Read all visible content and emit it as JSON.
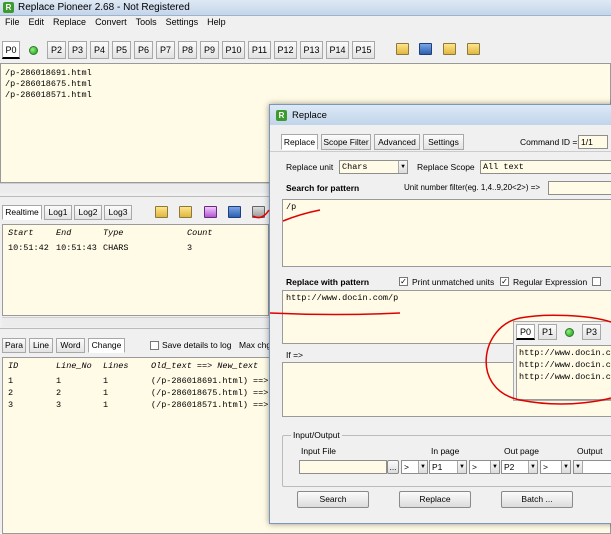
{
  "app": {
    "title": "Replace Pioneer 2.68 - Not Registered",
    "logo": "R"
  },
  "menu": [
    "File",
    "Edit",
    "Replace",
    "Convert",
    "Tools",
    "Settings",
    "Help"
  ],
  "ptabs": [
    "P0",
    "P2",
    "P3",
    "P4",
    "P5",
    "P6",
    "P7",
    "P8",
    "P9",
    "P10",
    "P11",
    "P12",
    "P13",
    "P14",
    "P15"
  ],
  "toolbar_icons": [
    "open-folder-icon",
    "save-icon",
    "export-icon",
    "excel-icon"
  ],
  "text_panel": {
    "lines": [
      "/p-286018691.html",
      "/p-286018675.html",
      "/p-286018571.html"
    ]
  },
  "log": {
    "tabs": [
      "Realtime",
      "Log1",
      "Log2",
      "Log3"
    ],
    "headers": [
      "Start",
      "End",
      "Type",
      "Count"
    ],
    "rows": [
      [
        "10:51:42",
        "10:51:43",
        "CHARS",
        "3"
      ]
    ]
  },
  "change": {
    "tabs": [
      "Para",
      "Line",
      "Word",
      "Change"
    ],
    "save_details_label": "Save details to log",
    "max_label": "Max chg",
    "headers": [
      "ID",
      "Line_No",
      "Lines",
      "Old_text ==> New_text"
    ],
    "rows": [
      [
        "1",
        "1",
        "1",
        "(/p-286018691.html) ==>"
      ],
      [
        "2",
        "2",
        "1",
        "(/p-286018675.html) ==>"
      ],
      [
        "3",
        "3",
        "1",
        "(/p-286018571.html) ==>"
      ]
    ]
  },
  "dialog": {
    "title": "Replace",
    "tabs": [
      "Replace",
      "Scope Filter",
      "Advanced",
      "Settings"
    ],
    "command_id_label": "Command ID =>",
    "command_id_value": "1/1",
    "replace_unit_label": "Replace unit",
    "replace_unit_value": "Chars",
    "replace_scope_label": "Replace Scope",
    "replace_scope_value": "All text",
    "search_label": "Search for pattern",
    "unit_filter_label": "Unit number filter(eg. 1,4..9,20<2>) =>",
    "search_value": "/p",
    "replace_with_label": "Replace with pattern",
    "print_unmatched_label": "Print unmatched units",
    "regex_label": "Regular Expression",
    "replace_value": "http://www.docin.com/p",
    "if_label": "If =>",
    "preview_tabs": [
      "P0",
      "P1",
      "P3"
    ],
    "preview_lines": [
      "http://www.docin.c",
      "http://www.docin.c",
      "http://www.docin.c"
    ],
    "io_label": "Input/Output",
    "input_file_label": "Input File",
    "in_page_label": "In page",
    "in_page_value": "P1",
    "out_page_label": "Out page",
    "out_page_value": "P2",
    "output_label": "Output",
    "browse_label": "...",
    "arrow_label": ">",
    "search_button": "Search",
    "replace_button": "Replace",
    "batch_button": "Batch ..."
  },
  "colors": {
    "panel_bg": "#fffbe6",
    "annotation_red": "#e00000",
    "status_green": "#22aa22"
  }
}
